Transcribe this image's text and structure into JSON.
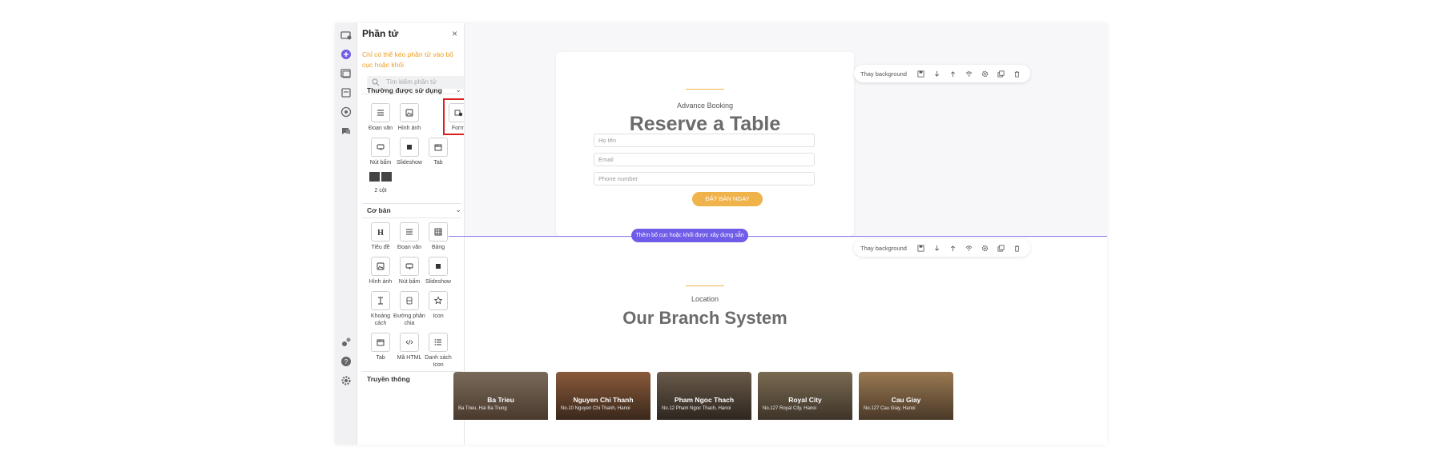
{
  "panel": {
    "title": "Phần tử",
    "close": "×",
    "hint": "Chỉ có thể kéo phần tử vào bố cục hoặc khối",
    "search_placeholder": "Tìm kiếm phần tử"
  },
  "sections": {
    "common": {
      "title": "Thường được sử dụng",
      "items": [
        {
          "label": "Đoạn văn",
          "icon": "paragraph-icon"
        },
        {
          "label": "Hình ảnh",
          "icon": "image-icon"
        },
        {
          "label": "Form",
          "icon": "form-icon"
        },
        {
          "label": "Nút bấm",
          "icon": "button-icon"
        },
        {
          "label": "Slideshow",
          "icon": "slideshow-icon"
        },
        {
          "label": "Tab",
          "icon": "tab-icon"
        },
        {
          "label": "2 cột",
          "icon": "two-column-icon"
        }
      ]
    },
    "basic": {
      "title": "Cơ bản",
      "items": [
        {
          "label": "Tiêu đề",
          "icon": "heading-icon"
        },
        {
          "label": "Đoạn văn",
          "icon": "paragraph-icon"
        },
        {
          "label": "Bảng",
          "icon": "table-icon"
        },
        {
          "label": "Hình ảnh",
          "icon": "image-icon"
        },
        {
          "label": "Nút bấm",
          "icon": "button-icon"
        },
        {
          "label": "Slideshow",
          "icon": "slideshow-icon"
        },
        {
          "label": "Khoảng cách",
          "icon": "spacing-icon"
        },
        {
          "label": "Đường phân chia",
          "icon": "divider-icon"
        },
        {
          "label": "Icon",
          "icon": "star-icon"
        },
        {
          "label": "Tab",
          "icon": "tab-icon"
        },
        {
          "label": "Mã HTML",
          "icon": "code-icon"
        },
        {
          "label": "Danh sách Icon",
          "icon": "icon-list-icon"
        }
      ]
    },
    "media": {
      "title": "Truyền thông"
    }
  },
  "section1": {
    "subtitle": "Advance Booking",
    "title": "Reserve a Table",
    "fields": [
      "Họ tên",
      "Email",
      "Phone number"
    ],
    "button": "ĐẶT BÀN NGAY"
  },
  "toolbar": {
    "label": "Thay background"
  },
  "add_layout": "Thêm bố cục hoặc khối được xây dựng sẵn",
  "section2": {
    "subtitle": "Location",
    "title": "Our Branch System",
    "branches": [
      {
        "name": "Ba Trieu",
        "addr": "Ba Trieu, Hai Ba Trung"
      },
      {
        "name": "Nguyen Chi Thanh",
        "addr": "No.10 Nguyen Chi Thanh, Hanoi"
      },
      {
        "name": "Pham Ngoc Thach",
        "addr": "No.12 Pham Ngoc Thach, Hanoi"
      },
      {
        "name": "Royal City",
        "addr": "No.127 Royal City, Hanoi"
      },
      {
        "name": "Cau Giay",
        "addr": "No.127 Cau Giay, Hanoi"
      }
    ]
  },
  "colors": {
    "accent": "#f0b24a",
    "primary": "#6f5ce8",
    "highlight": "#d91f1f"
  }
}
